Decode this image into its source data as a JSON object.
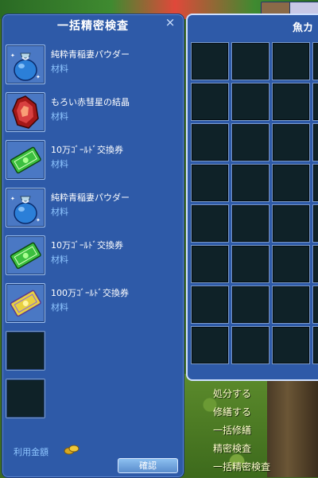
{
  "inspect_panel": {
    "title": "一括精密検査",
    "close_label": "×",
    "items": [
      {
        "name": "純粋青稲妻パウダー",
        "type": "材料",
        "icon": "blue-pouch-icon"
      },
      {
        "name": "もろい赤彗星の結晶",
        "type": "材料",
        "icon": "red-crystal-icon"
      },
      {
        "name": "10万ｺﾞｰﾙﾄﾞ交換券",
        "type": "材料",
        "icon": "green-ticket-icon"
      },
      {
        "name": "純粋青稲妻パウダー",
        "type": "材料",
        "icon": "blue-pouch-icon"
      },
      {
        "name": "10万ｺﾞｰﾙﾄﾞ交換券",
        "type": "材料",
        "icon": "green-ticket-icon"
      },
      {
        "name": "100万ｺﾞｰﾙﾄﾞ交換券",
        "type": "材料",
        "icon": "gold-ticket-icon"
      }
    ],
    "money_label": "利用金額",
    "confirm_label": "確認"
  },
  "inventory_panel": {
    "title": "魚カ"
  },
  "context_menu": [
    "処分する",
    "修繕する",
    "一括修繕",
    "精密検査",
    "一括精密検査"
  ]
}
